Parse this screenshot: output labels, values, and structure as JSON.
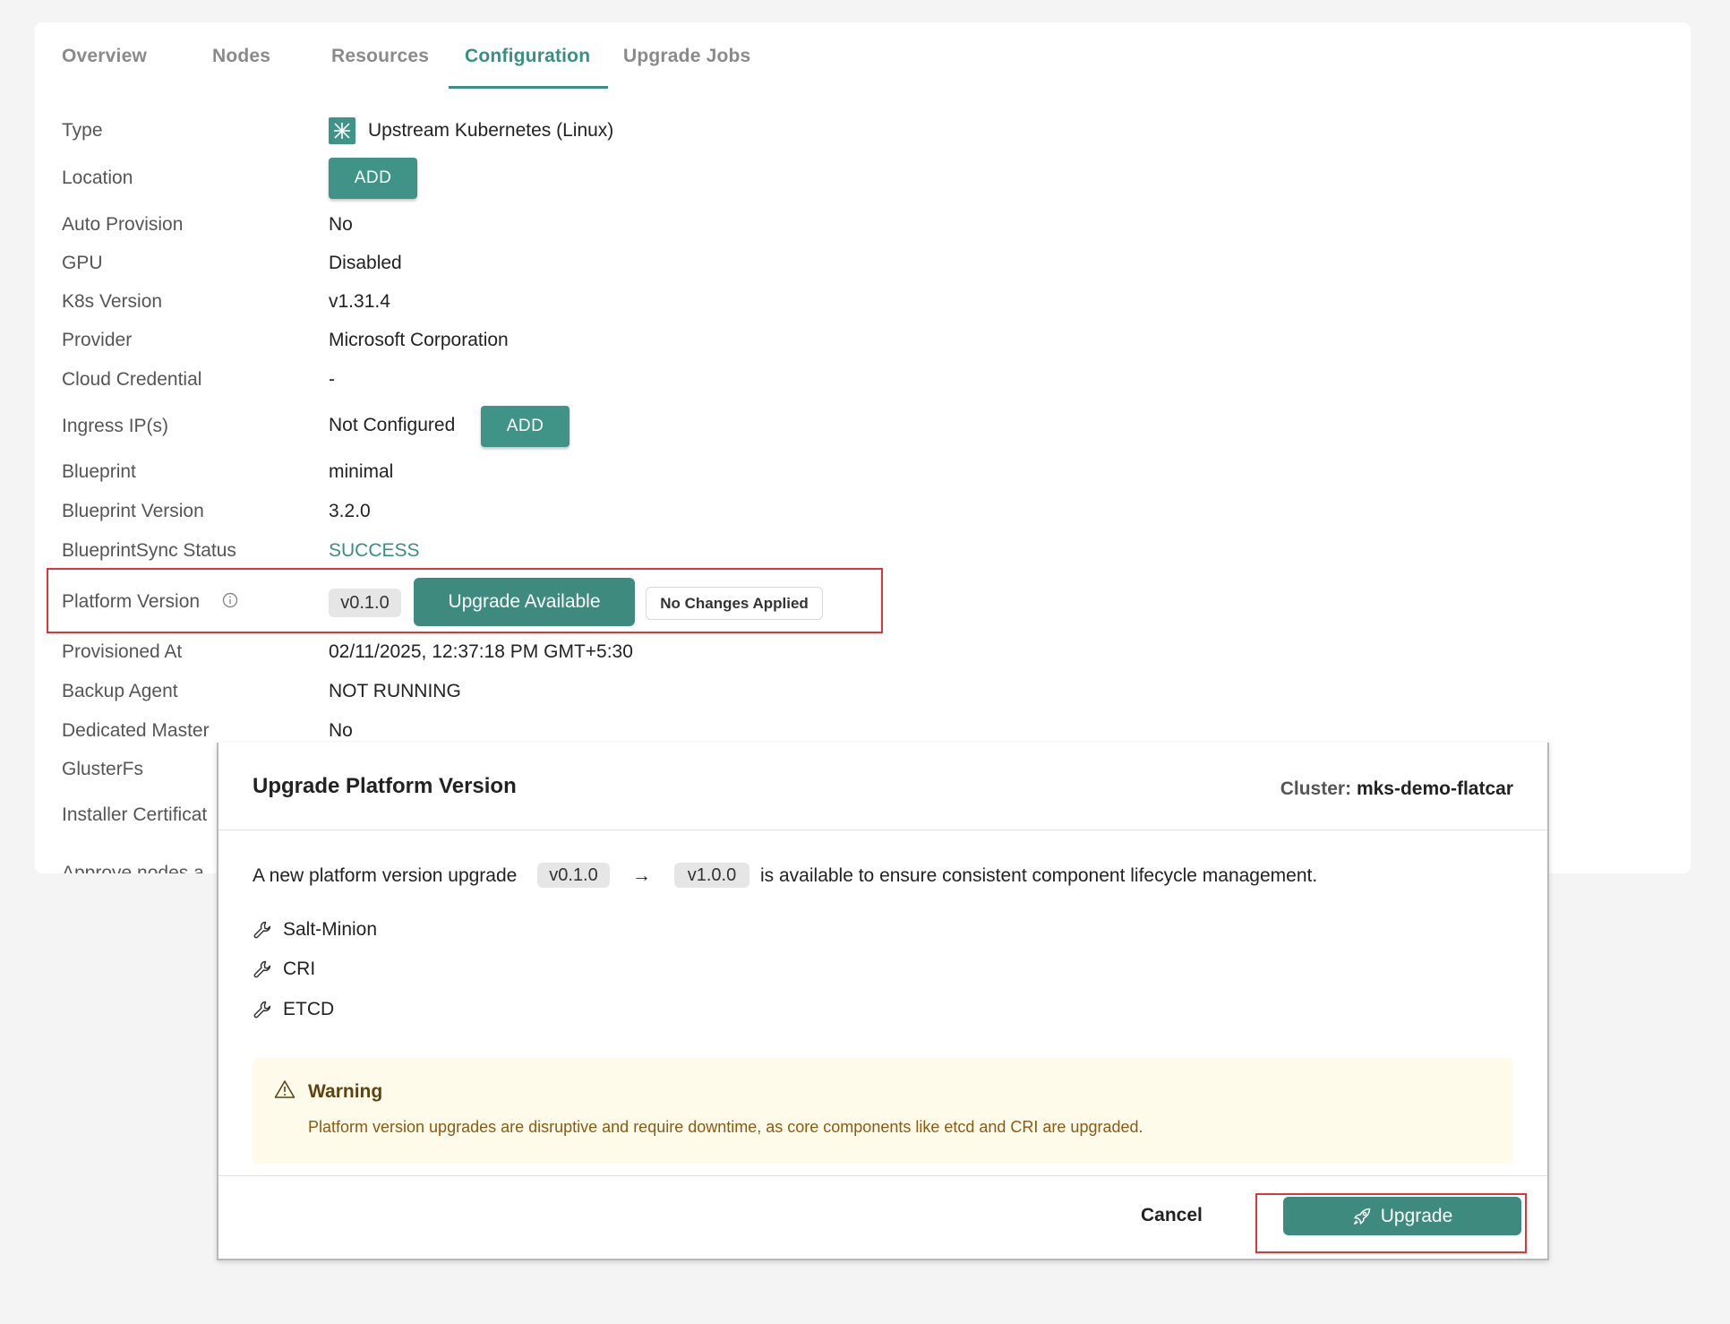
{
  "tabs": [
    {
      "label": "Overview",
      "active": false
    },
    {
      "label": "Nodes",
      "active": false
    },
    {
      "label": "Resources",
      "active": false
    },
    {
      "label": "Configuration",
      "active": true
    },
    {
      "label": "Upgrade Jobs",
      "active": false
    }
  ],
  "config": {
    "type": {
      "label": "Type",
      "value": "Upstream Kubernetes (Linux)",
      "icon": "kubernetes-icon"
    },
    "location": {
      "label": "Location",
      "button": "ADD"
    },
    "auto_provision": {
      "label": "Auto Provision",
      "value": "No"
    },
    "gpu": {
      "label": "GPU",
      "value": "Disabled"
    },
    "k8s_version": {
      "label": "K8s Version",
      "value": "v1.31.4"
    },
    "provider": {
      "label": "Provider",
      "value": "Microsoft Corporation"
    },
    "cloud_credential": {
      "label": "Cloud Credential",
      "value": "-"
    },
    "ingress_ips": {
      "label": "Ingress IP(s)",
      "value": "Not Configured",
      "button": "ADD"
    },
    "blueprint": {
      "label": "Blueprint",
      "value": "minimal"
    },
    "blueprint_version": {
      "label": "Blueprint Version",
      "value": "3.2.0"
    },
    "blueprint_sync_status": {
      "label": "BlueprintSync Status",
      "value": "SUCCESS"
    },
    "platform_version": {
      "label": "Platform Version",
      "value": "v0.1.0",
      "upgrade_button": "Upgrade Available",
      "badge": "No Changes Applied"
    },
    "provisioned_at": {
      "label": "Provisioned At",
      "value": "02/11/2025, 12:37:18 PM GMT+5:30"
    },
    "backup_agent": {
      "label": "Backup Agent",
      "value": "NOT RUNNING"
    },
    "dedicated_master": {
      "label": "Dedicated Master",
      "value": "No"
    },
    "glusterfs": {
      "label": "GlusterFs"
    },
    "installer_certificate": {
      "label": "Installer Certificat"
    },
    "approve_nodes": {
      "label": "Approve nodes a"
    }
  },
  "dialog": {
    "title": "Upgrade Platform Version",
    "cluster_label": "Cluster:",
    "cluster_name": "mks-demo-flatcar",
    "intro": "A new platform version upgrade",
    "from_version": "v0.1.0",
    "arrow": "→",
    "to_version": "v1.0.0",
    "intro_suffix": "is available to ensure consistent component lifecycle management.",
    "components": [
      "Salt-Minion",
      "CRI",
      "ETCD"
    ],
    "warning_title": "Warning",
    "warning_text": "Platform version upgrades are disruptive and require downtime, as core components like etcd and CRI are upgraded.",
    "cancel_label": "Cancel",
    "upgrade_label": "Upgrade"
  },
  "colors": {
    "accent": "#3f8a7f",
    "highlight": "#d9363e",
    "warning_bg": "#fffbea"
  }
}
